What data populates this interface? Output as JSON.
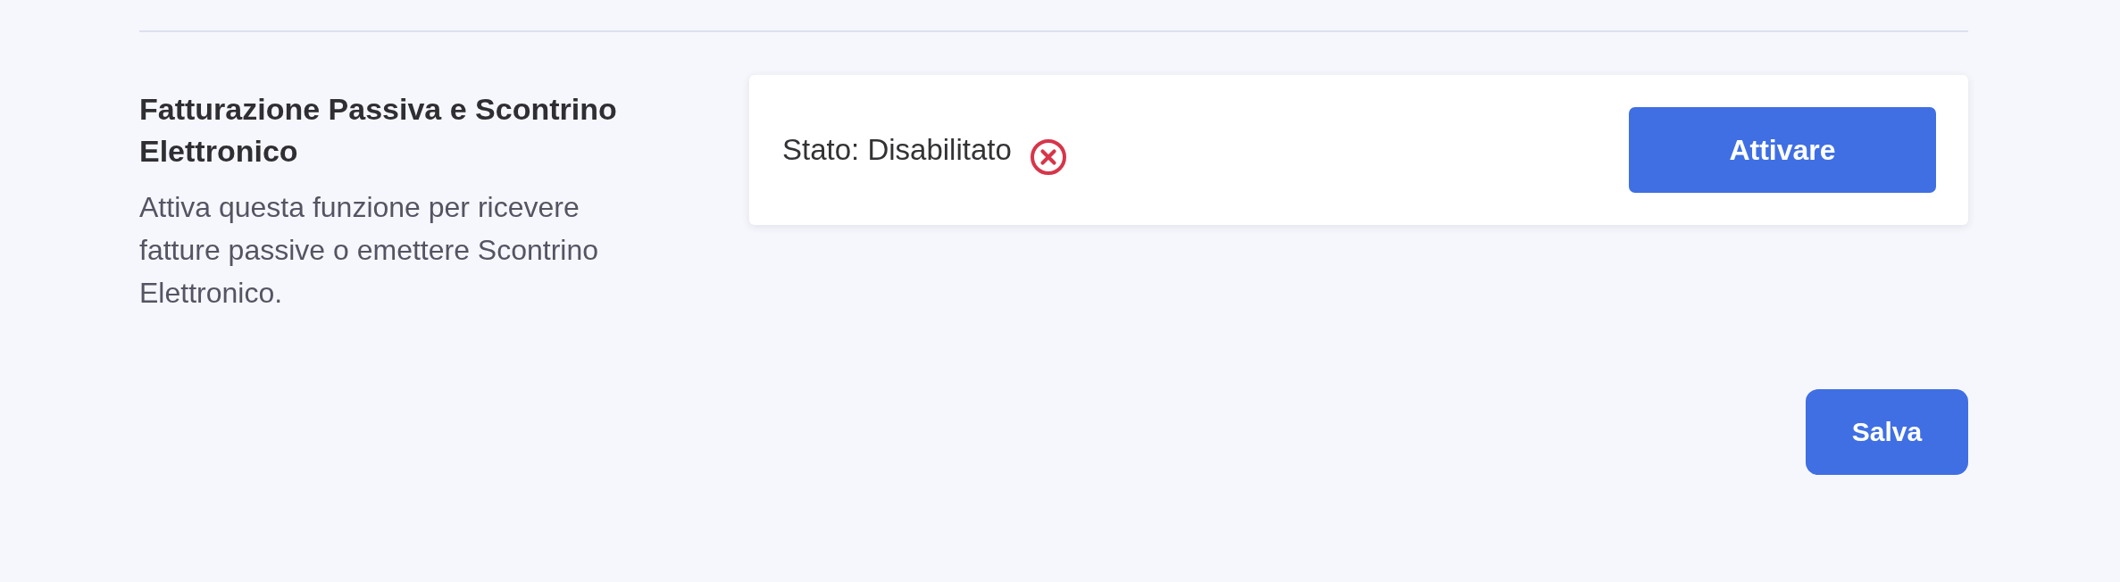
{
  "section": {
    "title": "Fatturazione Passiva e Scontrino Elettronico",
    "description": "Attiva questa funzione per ricevere fatture passive o emettere Scontrino Elettronico."
  },
  "status_card": {
    "label": "Stato: Disabilitato",
    "enabled": false,
    "action": "Attivare"
  },
  "footer": {
    "save_label": "Salva"
  }
}
